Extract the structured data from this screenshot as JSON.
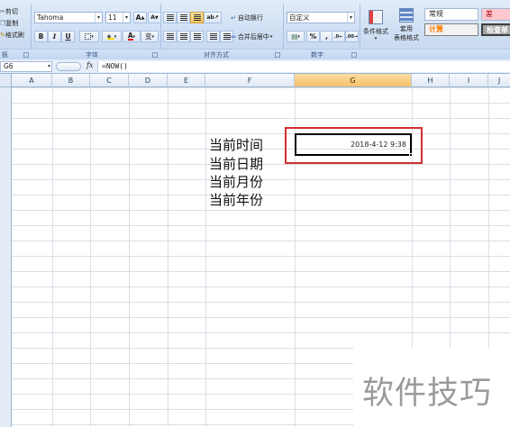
{
  "ribbon": {
    "clipboard": {
      "cut": "剪切",
      "copy": "复制",
      "format_painter": "格式刷",
      "group": "板"
    },
    "font": {
      "name": "Tahoma",
      "size": "11",
      "grow": "A",
      "shrink": "A",
      "bold": "B",
      "italic": "I",
      "underline": "U",
      "font_color_letter": "A",
      "wen": "变",
      "group": "字体"
    },
    "alignment": {
      "wrap_text": "自动换行",
      "merge_center": "合并后居中",
      "group": "对齐方式"
    },
    "number": {
      "format": "自定义",
      "percent": "%",
      "comma": ",",
      "group": "数字"
    },
    "styles": {
      "conditional": "条件格式",
      "table_line1": "套用",
      "table_line2": "表格格式",
      "normal": "常规",
      "bad": "差",
      "calc": "计算",
      "check": "检查单",
      "colors": {
        "normal_bg": "#ffffff",
        "bad_bg": "#ffc7ce",
        "bad_fg": "#9c0006",
        "calc_bg": "#f2f2f2",
        "calc_fg": "#fa7d00",
        "check_bg": "#a5a5a5"
      }
    },
    "icons": [
      "scissors-icon",
      "copy-icon",
      "format-painter-icon",
      "bold-icon",
      "italic-icon",
      "underline-icon",
      "border-icon",
      "fill-color-icon",
      "font-color-icon",
      "conditional-format-icon",
      "table-style-icon"
    ]
  },
  "formula_bar": {
    "name_box": "G6",
    "fx": "fx",
    "formula": "=NOW()"
  },
  "sheet": {
    "columns": [
      "A",
      "B",
      "C",
      "D",
      "E",
      "F",
      "G",
      "H",
      "I",
      "J"
    ],
    "selected_column": "G",
    "labels": [
      "当前时间",
      "当前日期",
      "当前月份",
      "当前年份"
    ],
    "active_cell": {
      "ref": "G6",
      "value": "2018-4-12 9:38"
    },
    "highlight_color": "#d32f2f"
  },
  "watermark": "软件技巧"
}
